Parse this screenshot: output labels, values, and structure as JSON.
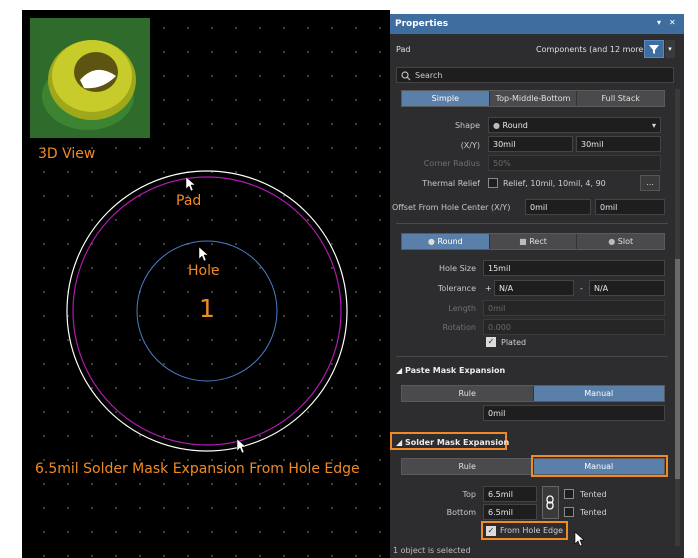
{
  "canvas": {
    "view3d_label": "3D View",
    "pad_label": "Pad",
    "hole_label": "Hole",
    "pad_number": "1",
    "expansion_caption": "6.5mil Solder Mask Expansion From Hole Edge"
  },
  "panel": {
    "title": "Properties",
    "object_type": "Pad",
    "filter_text": "Components (and 12 more)",
    "search_placeholder": "Search",
    "layer_tabs": [
      "Simple",
      "Top-Middle-Bottom",
      "Full Stack"
    ],
    "shape": {
      "label": "Shape",
      "value": "Round"
    },
    "xy": {
      "label": "(X/Y)",
      "x": "30mil",
      "y": "30mil"
    },
    "corner_radius": {
      "label": "Corner Radius",
      "value": "50%"
    },
    "thermal_relief": {
      "label": "Thermal Relief",
      "value": "Relief, 10mil, 10mil, 4, 90",
      "button": "..."
    },
    "offset": {
      "label": "Offset From Hole Center (X/Y)",
      "x": "0mil",
      "y": "0mil"
    },
    "hole_shape_tabs": [
      "Round",
      "Rect",
      "Slot"
    ],
    "hole_size": {
      "label": "Hole Size",
      "value": "15mil"
    },
    "tolerance": {
      "label": "Tolerance",
      "plus_sign": "+",
      "plus": "N/A",
      "minus_sign": "-",
      "minus": "N/A"
    },
    "length": {
      "label": "Length",
      "value": "0mil"
    },
    "rotation": {
      "label": "Rotation",
      "value": "0.000"
    },
    "plated": {
      "label": "Plated",
      "checked": true
    },
    "paste_mask": {
      "title": "Paste Mask Expansion",
      "tabs": [
        "Rule",
        "Manual"
      ],
      "value": "0mil"
    },
    "solder_mask": {
      "title": "Solder Mask Expansion",
      "tabs": [
        "Rule",
        "Manual"
      ],
      "top_label": "Top",
      "top": "6.5mil",
      "bottom_label": "Bottom",
      "bottom": "6.5mil",
      "tented_label": "Tented",
      "from_hole_edge": "From Hole Edge"
    },
    "status": "1 object is selected"
  },
  "colors": {
    "accent_orange": "#f08a24",
    "panel_bg": "#2d2d30",
    "active_tab": "#5a7fa8",
    "pad_outline": "#ffffff",
    "mask_ring": "#b01ab0",
    "hole_ring": "#4a7ec8"
  },
  "icons": [
    "filter-icon",
    "search-icon",
    "dropdown-arrow-icon",
    "link-chain-icon",
    "mouse-cursor-icon",
    "pin-icon",
    "close-icon"
  ]
}
